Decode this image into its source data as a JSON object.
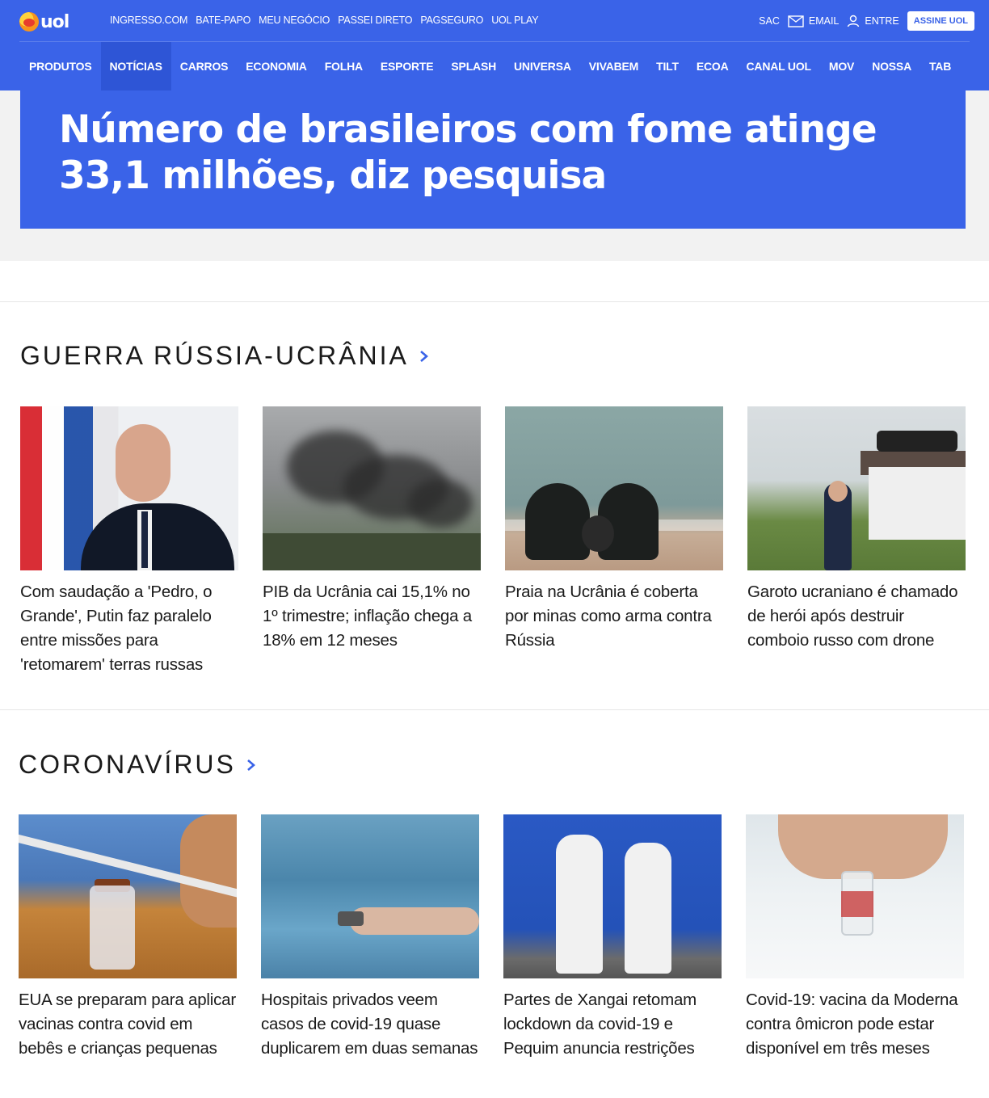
{
  "header": {
    "logo_text": "uol",
    "top_links": [
      "INGRESSO.COM",
      "BATE-PAPO",
      "MEU NEGÓCIO",
      "PASSEI DIRETO",
      "PAGSEGURO",
      "UOL PLAY"
    ],
    "sac": "SAC",
    "email": "EMAIL",
    "entre": "ENTRE",
    "assine": "ASSINE UOL"
  },
  "nav": {
    "items": [
      "PRODUTOS",
      "NOTÍCIAS",
      "CARROS",
      "ECONOMIA",
      "FOLHA",
      "ESPORTE",
      "SPLASH",
      "UNIVERSA",
      "VIVABEM",
      "TILT",
      "ECOA",
      "CANAL UOL",
      "MOV",
      "NOSSA",
      "TAB"
    ],
    "active": "NOTÍCIAS"
  },
  "hero": {
    "headline": "Número de brasileiros com fome atinge 33,1 milhões, diz pesquisa"
  },
  "sections": [
    {
      "title": "GUERRA RÚSSIA-UCRÂNIA",
      "cards": [
        {
          "text": "Com saudação a 'Pedro, o Grande', Putin faz paralelo entre missões para 'retomarem' terras russas"
        },
        {
          "text": "PIB da Ucrânia cai 15,1% no 1º trimestre; inflação chega a 18% em 12 meses"
        },
        {
          "text": "Praia na Ucrânia é coberta por minas como arma contra Rússia"
        },
        {
          "text": "Garoto ucraniano é chamado de herói após destruir comboio russo com drone"
        }
      ]
    },
    {
      "title": "CORONAVÍRUS",
      "cards": [
        {
          "text": "EUA se preparam para aplicar vacinas contra covid em bebês e crianças pequenas"
        },
        {
          "text": "Hospitais privados veem casos de covid-19 quase duplicarem em duas semanas"
        },
        {
          "text": "Partes de Xangai retomam lockdown da covid-19 e Pequim anuncia restrições"
        },
        {
          "text": "Covid-19: vacina da Moderna contra ômicron pode estar disponível em três meses"
        }
      ]
    }
  ],
  "colors": {
    "brand_blue": "#3a63e8",
    "nav_active": "#2e55d6"
  }
}
